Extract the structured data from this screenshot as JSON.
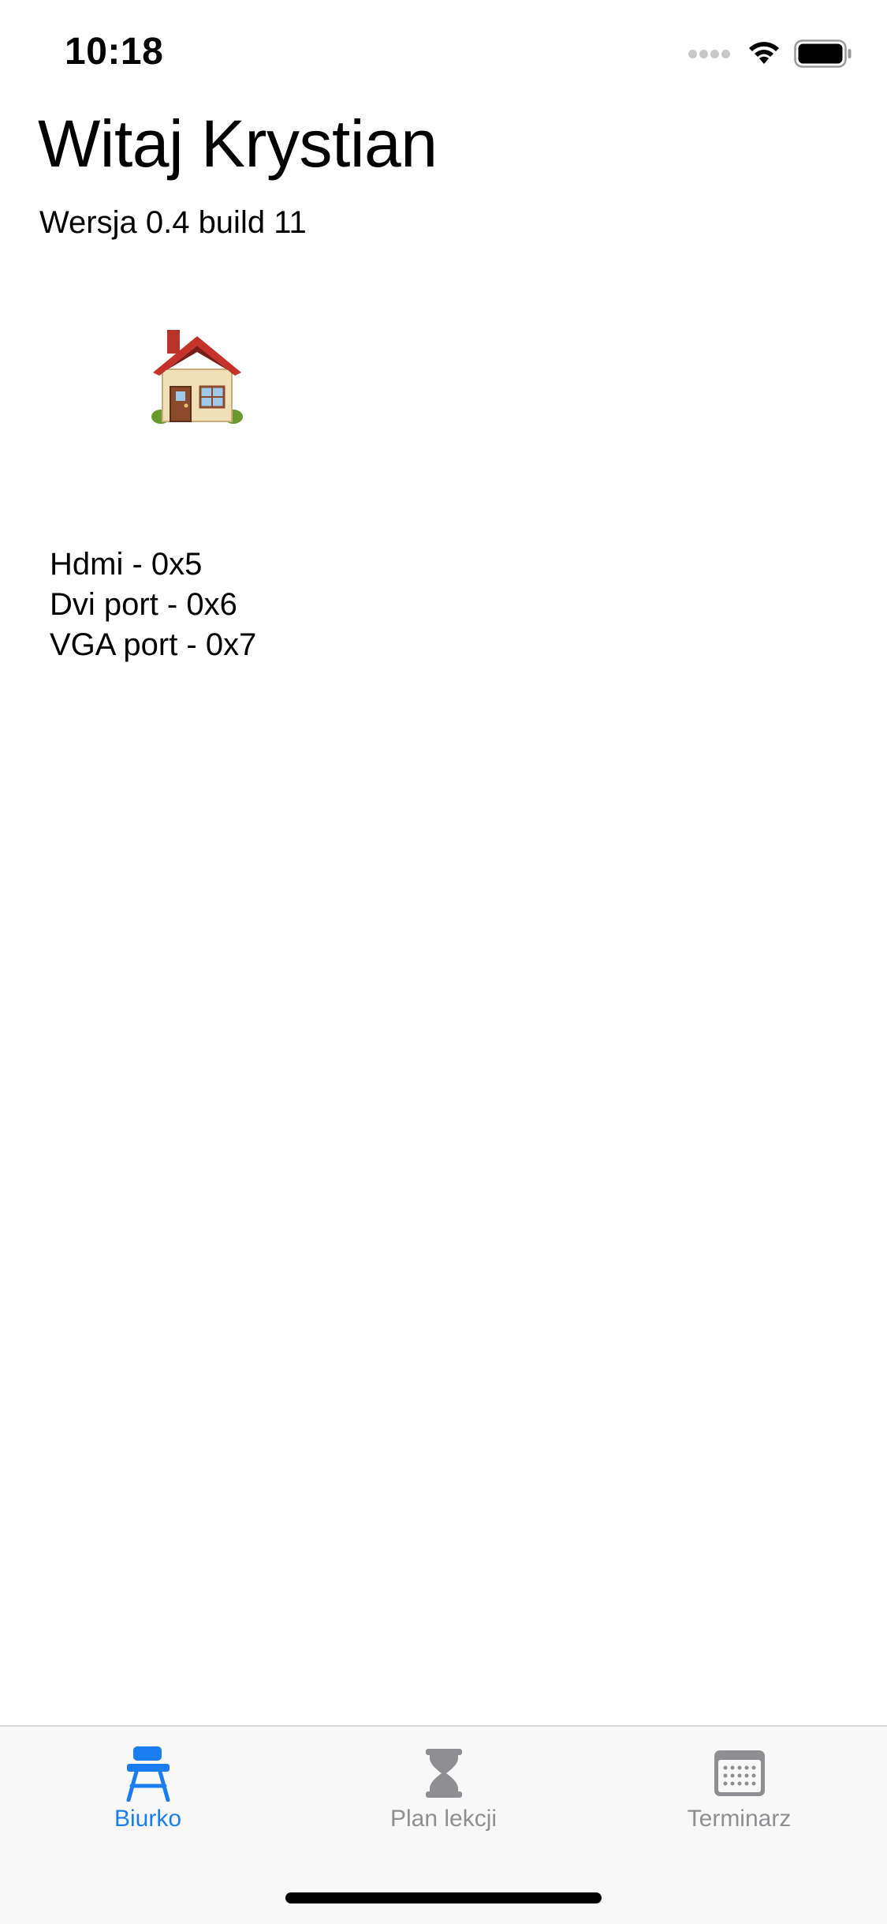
{
  "status_bar": {
    "time": "10:18"
  },
  "header": {
    "title": "Witaj Krystian",
    "version": "Wersja 0.4 build 11"
  },
  "main": {
    "house_icon": "house-icon",
    "ports": [
      "Hdmi - 0x5",
      "Dvi port - 0x6",
      "VGA port - 0x7"
    ]
  },
  "tab_bar": {
    "tabs": [
      {
        "label": "Biurko",
        "icon": "desk-icon",
        "active": true
      },
      {
        "label": "Plan lekcji",
        "icon": "hourglass-icon",
        "active": false
      },
      {
        "label": "Terminarz",
        "icon": "calendar-icon",
        "active": false
      }
    ]
  },
  "colors": {
    "accent": "#1a7ef0",
    "inactive": "#8e8e93"
  }
}
